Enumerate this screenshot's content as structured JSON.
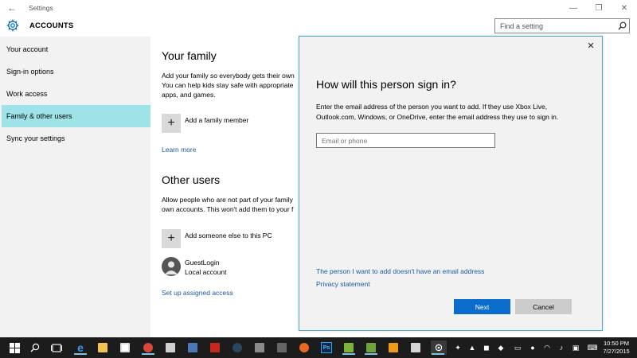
{
  "window": {
    "title": "Settings",
    "back_glyph": "←",
    "minimize_glyph": "—",
    "maximize_glyph": "❐",
    "close_glyph": "✕"
  },
  "header": {
    "title": "ACCOUNTS",
    "icon": "gear-icon",
    "search_placeholder": "Find a setting"
  },
  "sidebar": {
    "items": [
      {
        "label": "Your account",
        "active": false
      },
      {
        "label": "Sign-in options",
        "active": false
      },
      {
        "label": "Work access",
        "active": false
      },
      {
        "label": "Family & other users",
        "active": true
      },
      {
        "label": "Sync your settings",
        "active": false
      }
    ]
  },
  "main": {
    "family": {
      "heading": "Your family",
      "line1": "Add your family so everybody gets their own",
      "line2": "You can help kids stay safe with appropriate",
      "line3": "apps, and games.",
      "add_label": "Add a family member",
      "learn_more": "Learn more"
    },
    "others": {
      "heading": "Other users",
      "line1": "Allow people who are not part of your family",
      "line2": "own accounts. This won't add them to your f",
      "add_label": "Add someone else to this PC",
      "user_name": "GuestLogin",
      "user_type": "Local account",
      "assigned_access": "Set up assigned access"
    }
  },
  "dialog": {
    "close_glyph": "✕",
    "title": "How will this person sign in?",
    "desc_line1": "Enter the email address of the person you want to add. If they use Xbox Live,",
    "desc_line2": "Outlook.com, Windows, or OneDrive, enter the email address they use to sign in.",
    "email_placeholder": "Email or phone",
    "email_value": "",
    "no_email_link": "The person I want to add doesn't have an email address",
    "privacy_link": "Privacy statement",
    "next_label": "Next",
    "cancel_label": "Cancel",
    "accent_color": "#0a6ccb"
  },
  "taskbar": {
    "apps": [
      {
        "name": "start-icon"
      },
      {
        "name": "search-icon"
      },
      {
        "name": "task-view-icon"
      },
      {
        "name": "edge-icon"
      },
      {
        "name": "file-explorer-icon"
      },
      {
        "name": "store-icon"
      },
      {
        "name": "chrome-icon"
      },
      {
        "name": "app-icon-1"
      },
      {
        "name": "app-icon-2"
      },
      {
        "name": "app-icon-3"
      },
      {
        "name": "steam-icon"
      },
      {
        "name": "app-icon-4"
      },
      {
        "name": "app-icon-5"
      },
      {
        "name": "firefox-icon"
      },
      {
        "name": "photoshop-icon"
      },
      {
        "name": "app-icon-6"
      },
      {
        "name": "app-icon-7"
      },
      {
        "name": "app-icon-8"
      },
      {
        "name": "app-icon-9"
      },
      {
        "name": "settings-icon"
      }
    ],
    "ps_label": "Ps",
    "time": "10:50 PM",
    "date": "7/27/2015"
  }
}
